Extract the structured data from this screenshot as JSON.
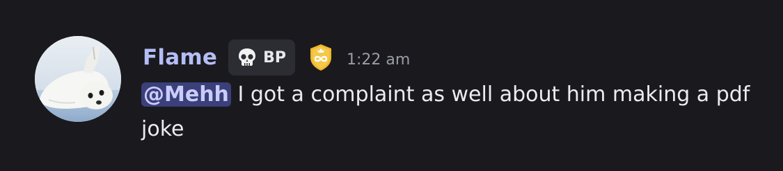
{
  "message": {
    "author": {
      "name": "Flame",
      "avatar": "seal-pup-avatar",
      "name_color": "#b5bdf7"
    },
    "server_tag": {
      "icon": "skull-icon",
      "label": "BP"
    },
    "badge": {
      "icon": "infinity-crest-badge-icon",
      "color": "#f1b82d"
    },
    "timestamp": "1:22 am",
    "mention": "@Mehh",
    "text": " I got a complaint as well about him making a pdf joke"
  },
  "colors": {
    "background": "#1a1a1e",
    "mention_bg": "#3b3f7a",
    "mention_text": "#c9cdfa"
  }
}
